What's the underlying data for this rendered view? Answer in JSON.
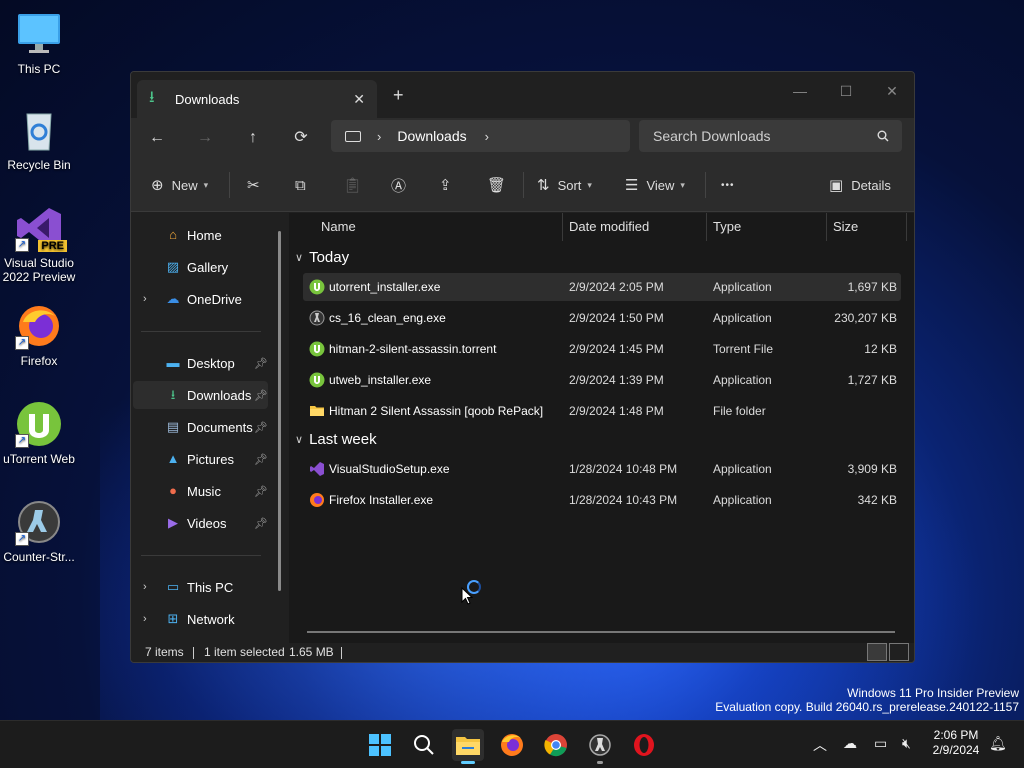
{
  "desktop": {
    "icons": [
      {
        "label": "This PC",
        "icon": "monitor-icon"
      },
      {
        "label": "Recycle Bin",
        "icon": "recycle-bin-icon"
      },
      {
        "label": "Visual Studio 2022 Preview",
        "icon": "visual-studio-icon",
        "badge": "PRE"
      },
      {
        "label": "Firefox",
        "icon": "firefox-icon"
      },
      {
        "label": "uTorrent Web",
        "icon": "utorrent-icon"
      },
      {
        "label": "Counter-Str...",
        "icon": "counter-strike-icon"
      }
    ]
  },
  "window": {
    "tab_title": "Downloads",
    "new_tab": "+",
    "nav": {
      "breadcrumb": "Downloads",
      "search_placeholder": "Search Downloads"
    },
    "toolbar": {
      "new_label": "New",
      "sort_label": "Sort",
      "view_label": "View",
      "more_label": "•••",
      "details_label": "Details"
    },
    "sidebar": {
      "top": [
        {
          "label": "Home",
          "icon": "home-icon"
        },
        {
          "label": "Gallery",
          "icon": "gallery-icon"
        },
        {
          "label": "OneDrive",
          "icon": "onedrive-icon"
        }
      ],
      "quick": [
        {
          "label": "Desktop",
          "icon": "desktop-icon"
        },
        {
          "label": "Downloads",
          "icon": "download-icon"
        },
        {
          "label": "Documents",
          "icon": "documents-icon"
        },
        {
          "label": "Pictures",
          "icon": "pictures-icon"
        },
        {
          "label": "Music",
          "icon": "music-icon"
        },
        {
          "label": "Videos",
          "icon": "videos-icon"
        }
      ],
      "bottom": [
        {
          "label": "This PC",
          "icon": "this-pc-icon"
        },
        {
          "label": "Network",
          "icon": "network-icon"
        }
      ]
    },
    "columns": {
      "name": "Name",
      "date": "Date modified",
      "type": "Type",
      "size": "Size"
    },
    "groups": [
      {
        "label": "Today",
        "files": [
          {
            "name": "utorrent_installer.exe",
            "date": "2/9/2024 2:05 PM",
            "type": "Application",
            "size": "1,697 KB",
            "icon": "utorrent-icon"
          },
          {
            "name": "cs_16_clean_eng.exe",
            "date": "2/9/2024 1:50 PM",
            "type": "Application",
            "size": "230,207 KB",
            "icon": "counter-strike-icon"
          },
          {
            "name": "hitman-2-silent-assassin.torrent",
            "date": "2/9/2024 1:45 PM",
            "type": "Torrent File",
            "size": "12 KB",
            "icon": "utorrent-icon"
          },
          {
            "name": "utweb_installer.exe",
            "date": "2/9/2024 1:39 PM",
            "type": "Application",
            "size": "1,727 KB",
            "icon": "utorrent-icon"
          },
          {
            "name": "Hitman 2 Silent Assassin [qoob RePack]",
            "date": "2/9/2024 1:48 PM",
            "type": "File folder",
            "size": "",
            "icon": "folder-icon"
          }
        ]
      },
      {
        "label": "Last week",
        "files": [
          {
            "name": "VisualStudioSetup.exe",
            "date": "1/28/2024 10:48 PM",
            "type": "Application",
            "size": "3,909 KB",
            "icon": "visual-studio-icon"
          },
          {
            "name": "Firefox Installer.exe",
            "date": "1/28/2024 10:43 PM",
            "type": "Application",
            "size": "342 KB",
            "icon": "firefox-icon"
          }
        ]
      }
    ],
    "status": {
      "items": "7 items",
      "selected": "1 item selected",
      "size": "1.65 MB"
    }
  },
  "watermark": {
    "line1": "Windows 11 Pro Insider Preview",
    "line2": "Evaluation copy. Build 26040.rs_prerelease.240122-1157"
  },
  "taskbar": {
    "time": "2:06 PM",
    "date": "2/9/2024"
  },
  "colors": {
    "accent": "#60cdff",
    "utorrent_green": "#78c43c",
    "folder_yellow": "#f5c542"
  }
}
